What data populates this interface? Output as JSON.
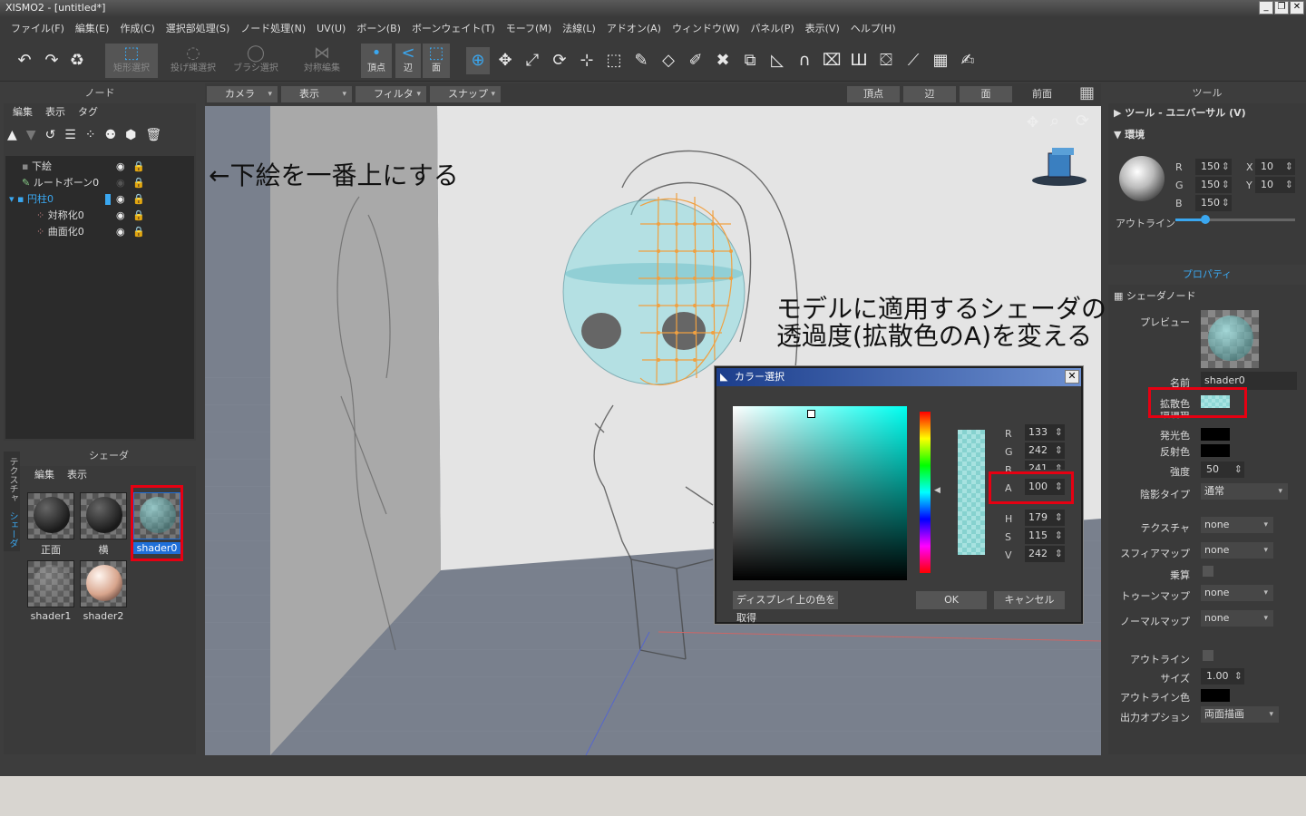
{
  "title": "XISMO2 - [untitled*]",
  "menu": [
    "ファイル(F)",
    "編集(E)",
    "作成(C)",
    "選択部処理(S)",
    "ノード処理(N)",
    "UV(U)",
    "ボーン(B)",
    "ボーンウェイト(T)",
    "モーフ(M)",
    "法線(L)",
    "アドオン(A)",
    "ウィンドウ(W)",
    "パネル(P)",
    "表示(V)",
    "ヘルプ(H)"
  ],
  "toolbar": {
    "rect_select": "矩形選択",
    "lasso_select": "投げ縄選択",
    "brush_select": "ブラシ選択",
    "symmetric_edit": "対称編集",
    "vertex": "頂点",
    "edge": "辺",
    "face": "面"
  },
  "node_panel": {
    "title": "ノード",
    "menu": [
      "編集",
      "表示",
      "タグ"
    ],
    "nodes": [
      "下絵",
      "ルートボーン0",
      "円柱0",
      "対称化0",
      "曲面化0"
    ]
  },
  "shader_panel": {
    "title": "シェーダ",
    "menu": [
      "編集",
      "表示"
    ],
    "tabs": [
      "テクスチャ",
      "シェーダ"
    ],
    "shaders": [
      "正面",
      "横",
      "shader0",
      "shader1",
      "shader2"
    ]
  },
  "viewport_bar": {
    "camera": "カメラ",
    "display": "表示",
    "filter": "フィルタ",
    "snap": "スナップ",
    "vertex": "頂点",
    "edge": "辺",
    "face": "面",
    "front": "前面"
  },
  "annotations": {
    "top": "←下絵を一番上にする",
    "right_line1": "モデルに適用するシェーダの",
    "right_line2": "透過度(拡散色のA)を変える"
  },
  "tool_panel": {
    "title": "ツール",
    "tool_name": "ツール - ユニバーサル (V)",
    "env": "環境",
    "r_label": "R",
    "r": "150",
    "g_label": "G",
    "g": "150",
    "b_label": "B",
    "b": "150",
    "x_label": "X",
    "x": "10",
    "y_label": "Y",
    "y": "10",
    "outline": "アウトライン",
    "outline_level": 0.25
  },
  "property_panel": {
    "title": "プロパティ",
    "section": "シェーダノード",
    "preview": "プレビュー",
    "name_label": "名前",
    "name": "shader0",
    "diffuse": "拡散色",
    "ambient": "環境色",
    "emissive": "発光色",
    "specular": "反射色",
    "power_label": "強度",
    "power": "50",
    "shading_label": "陰影タイプ",
    "shading": "通常",
    "texture_label": "テクスチャ",
    "texture": "none",
    "sphere_label": "スフィアマップ",
    "sphere": "none",
    "multiply": "乗算",
    "toon_label": "トゥーンマップ",
    "toon": "none",
    "normal_label": "ノーマルマップ",
    "normal": "none",
    "outline_label": "アウトライン",
    "size_label": "サイズ",
    "size": "1.00",
    "outline_color": "アウトライン色",
    "output_label": "出力オプション",
    "output": "両面描画"
  },
  "color_dialog": {
    "title": "カラー選択",
    "r_label": "R",
    "r": "133",
    "g_label": "G",
    "g": "242",
    "b_label": "B",
    "b": "241",
    "a_label": "A",
    "a": "100",
    "h_label": "H",
    "h": "179",
    "s_label": "S",
    "s": "115",
    "v_label": "V",
    "v": "242",
    "pick_screen": "ディスプレイ上の色を取得",
    "ok": "OK",
    "cancel": "キャンセル"
  },
  "colors": {
    "accent": "#3aa7f0",
    "annotation_box": "#e60012",
    "selected_shader": "#1f6fd8"
  }
}
